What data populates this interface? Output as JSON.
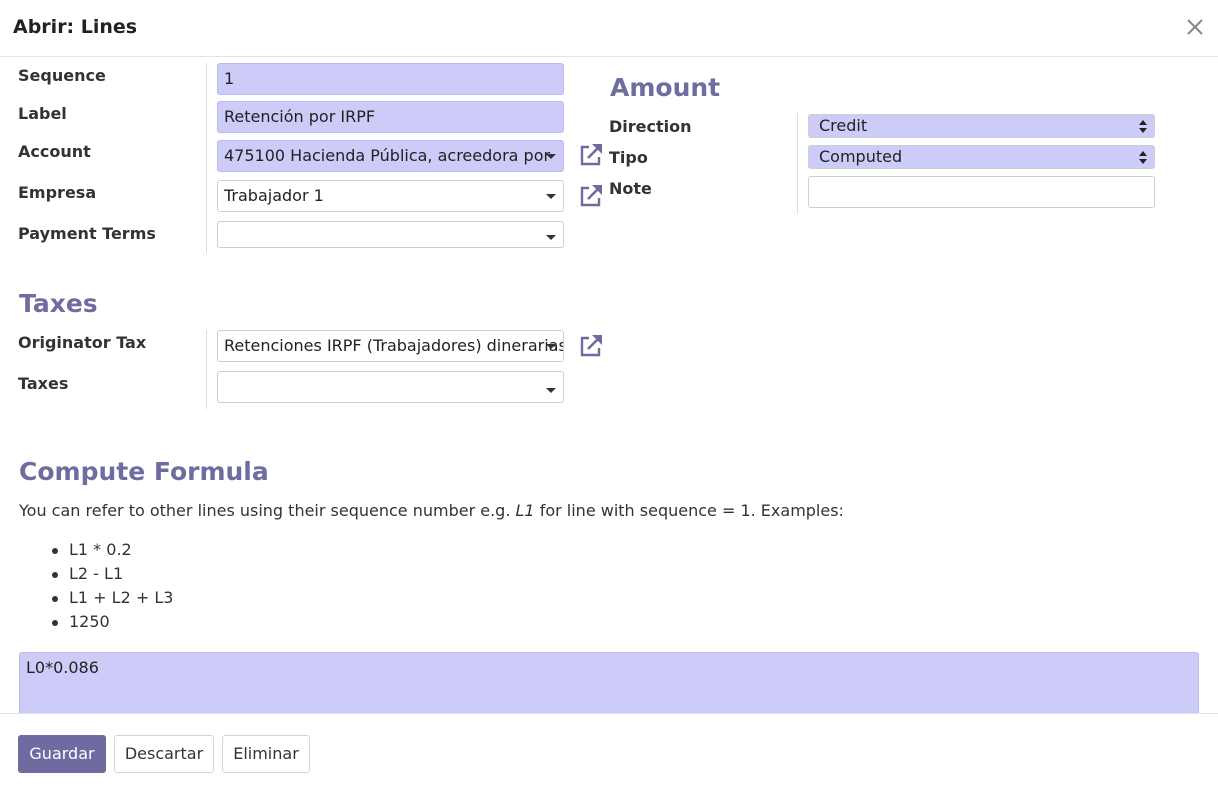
{
  "dialog": {
    "title": "Abrir: Lines",
    "close_icon": "close-icon"
  },
  "left_group": {
    "sequence": {
      "label": "Sequence",
      "value": "1"
    },
    "label": {
      "label": "Label",
      "value": "Retención por IRPF"
    },
    "account": {
      "label": "Account",
      "value": "475100 Hacienda Pública, acreedora por"
    },
    "empresa": {
      "label": "Empresa",
      "value": "Trabajador 1"
    },
    "payment_terms": {
      "label": "Payment Terms",
      "value": ""
    }
  },
  "amount": {
    "title": "Amount",
    "direction": {
      "label": "Direction",
      "value": "Credit"
    },
    "tipo": {
      "label": "Tipo",
      "value": "Computed"
    },
    "note": {
      "label": "Note",
      "value": ""
    }
  },
  "taxes": {
    "title": "Taxes",
    "originator_tax": {
      "label": "Originator Tax",
      "value": "Retenciones IRPF (Trabajadores) dinerarias"
    },
    "taxes": {
      "label": "Taxes",
      "value": ""
    }
  },
  "compute_formula": {
    "title": "Compute Formula",
    "help_before": "You can refer to other lines using their sequence number e.g. ",
    "help_em": "L1",
    "help_after": " for line with sequence = 1. Examples:",
    "examples": [
      "L1 * 0.2",
      "L2 - L1",
      "L1 + L2 + L3",
      "1250"
    ],
    "value": "L0*0.086"
  },
  "footer": {
    "save_label": "Guardar",
    "discard_label": "Descartar",
    "delete_label": "Eliminar"
  },
  "colors": {
    "required_field_bg": "#cdcbf8",
    "section_title": "#6f6c9f",
    "primary_button": "#6f6a9f",
    "external_link_icon": "#6f6a9f"
  }
}
